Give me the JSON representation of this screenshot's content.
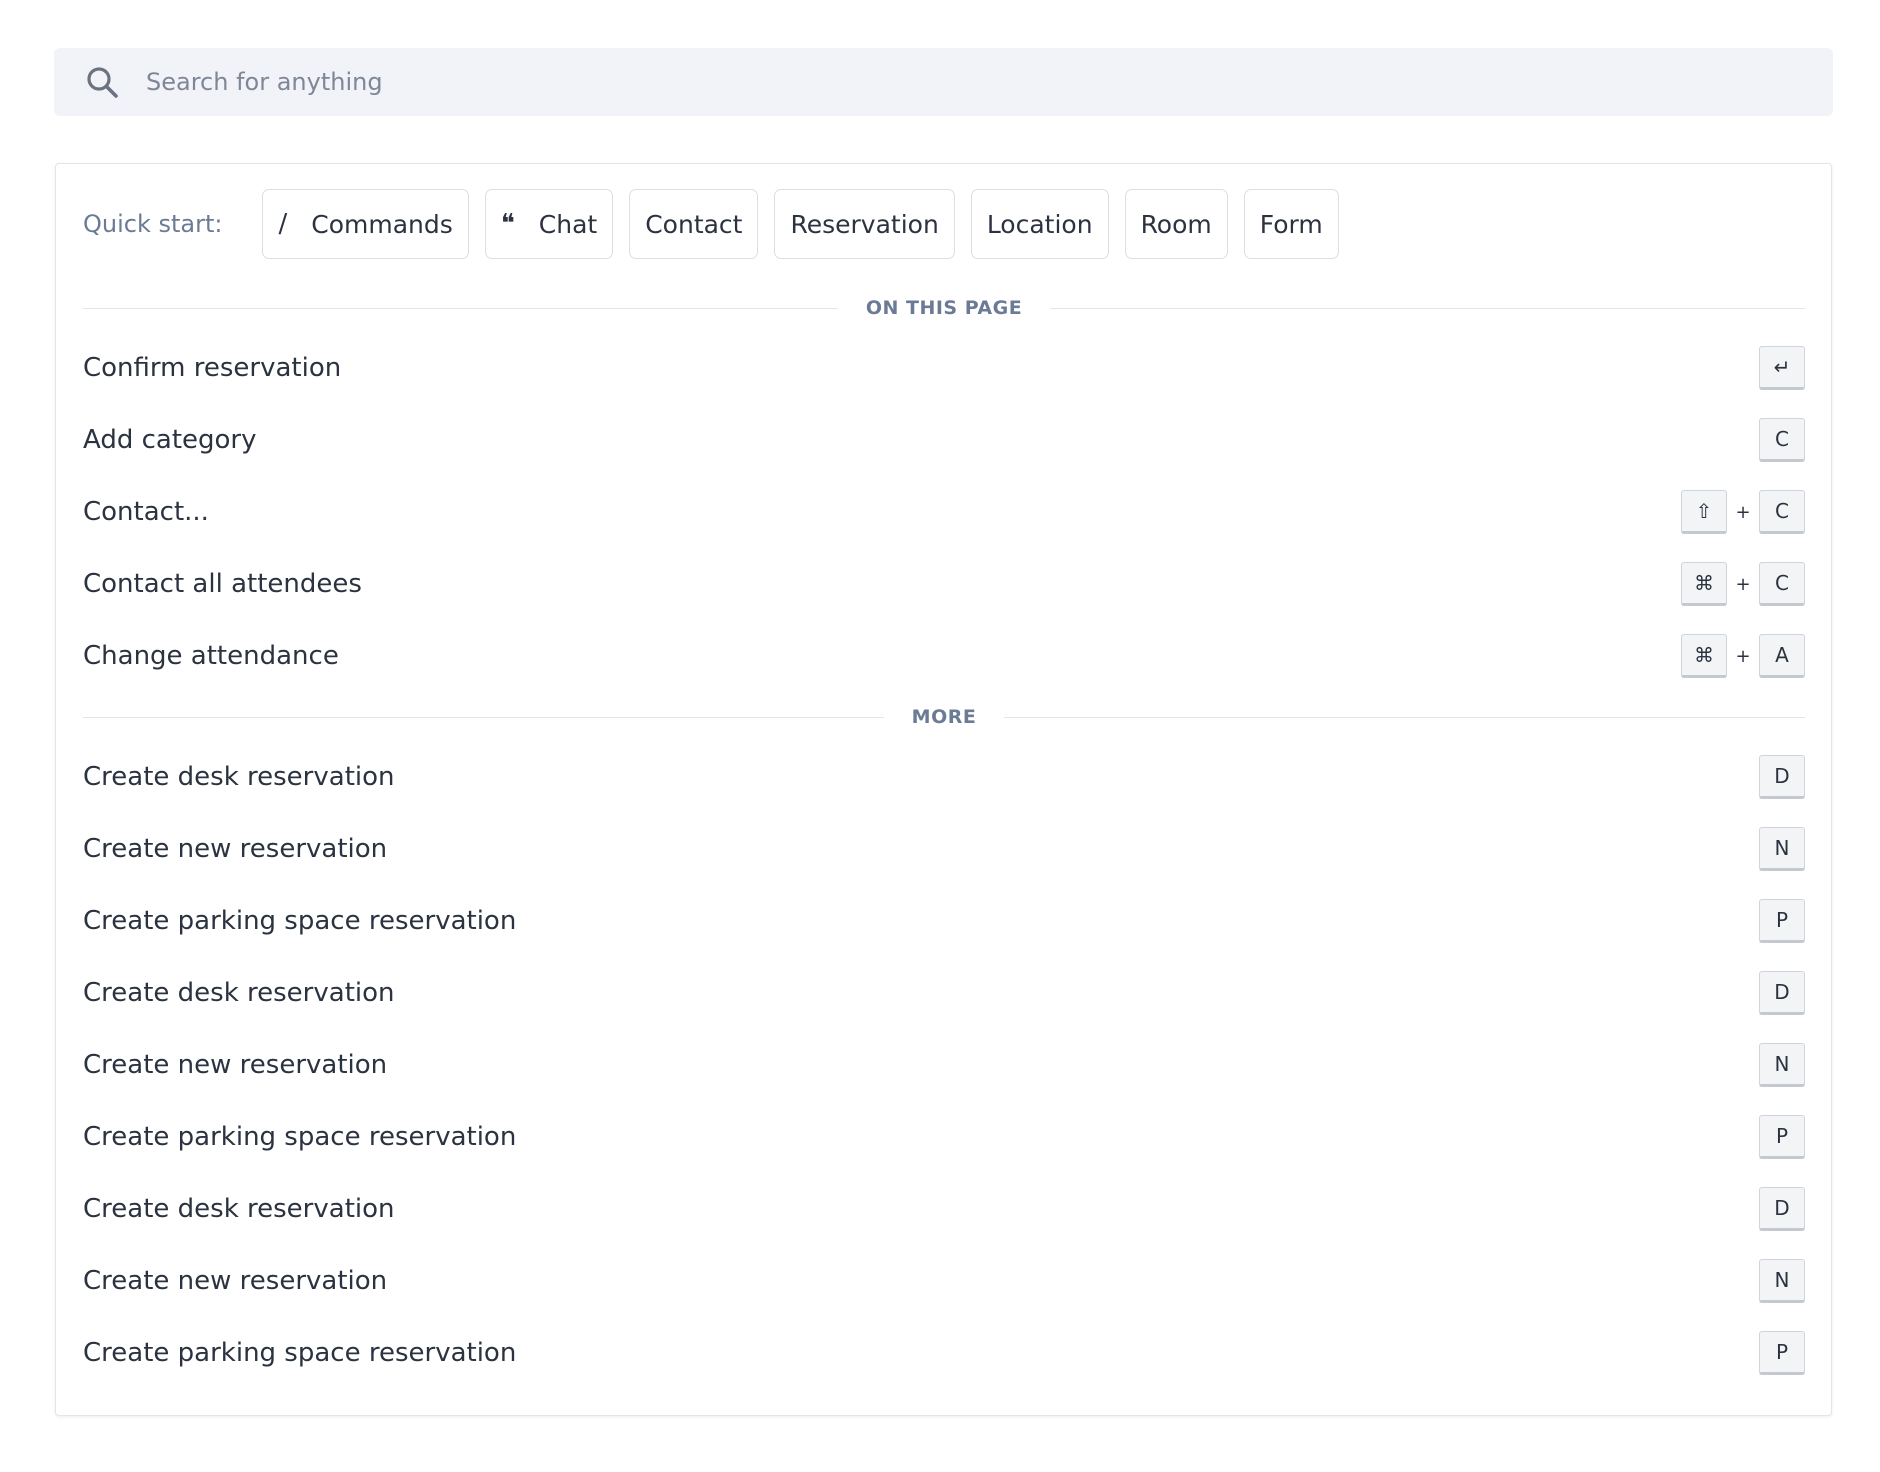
{
  "search": {
    "placeholder": "Search for anything",
    "icon": "search-icon"
  },
  "quick_start": {
    "label": "Quick start:",
    "chips": [
      {
        "label": "Commands",
        "icon": "slash-icon",
        "glyph": "/"
      },
      {
        "label": "Chat",
        "icon": "quote-icon",
        "glyph": "❝"
      },
      {
        "label": "Contact"
      },
      {
        "label": "Reservation"
      },
      {
        "label": "Location"
      },
      {
        "label": "Room"
      },
      {
        "label": "Form"
      }
    ]
  },
  "sections": {
    "on_this_page": {
      "title": "ON THIS PAGE",
      "items": [
        {
          "label": "Confirm reservation",
          "keys": [
            "↵"
          ]
        },
        {
          "label": "Add category",
          "keys": [
            "C"
          ]
        },
        {
          "label": "Contact...",
          "keys": [
            "⇧",
            "C"
          ]
        },
        {
          "label": "Contact all attendees",
          "keys": [
            "⌘",
            "C"
          ]
        },
        {
          "label": "Change attendance",
          "keys": [
            "⌘",
            "A"
          ]
        }
      ]
    },
    "more": {
      "title": "MORE",
      "items": [
        {
          "label": "Create desk reservation",
          "keys": [
            "D"
          ]
        },
        {
          "label": "Create new reservation",
          "keys": [
            "N"
          ]
        },
        {
          "label": "Create parking space reservation",
          "keys": [
            "P"
          ]
        },
        {
          "label": "Create desk reservation",
          "keys": [
            "D"
          ]
        },
        {
          "label": "Create new reservation",
          "keys": [
            "N"
          ]
        },
        {
          "label": "Create parking space reservation",
          "keys": [
            "P"
          ]
        },
        {
          "label": "Create desk reservation",
          "keys": [
            "D"
          ]
        },
        {
          "label": "Create new reservation",
          "keys": [
            "N"
          ]
        },
        {
          "label": "Create parking space reservation",
          "keys": [
            "P"
          ]
        }
      ]
    }
  },
  "key_separator": "+",
  "colors": {
    "search_bg": "#f1f3f8",
    "text": "#2c3340",
    "muted": "#6b7a95",
    "border": "#e2e5ea"
  }
}
